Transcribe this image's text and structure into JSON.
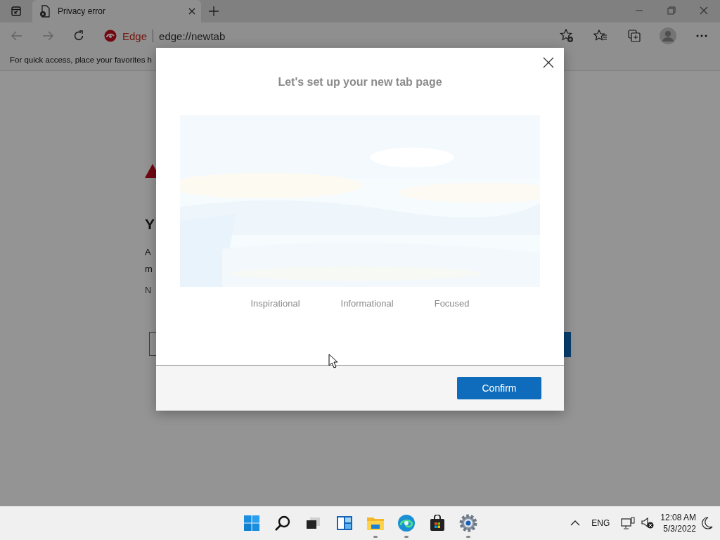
{
  "browser": {
    "tabs": [
      {
        "title": "Privacy error",
        "selected": true
      }
    ],
    "address": {
      "site_label": "Edge",
      "url": "edge://newtab"
    },
    "favorites_bar": {
      "hint": "For quick access, place your favorites h"
    }
  },
  "page": {
    "fragments": [
      {
        "kind": "heading",
        "text": "Y"
      },
      {
        "kind": "line",
        "text": "A"
      },
      {
        "kind": "line",
        "text": "m"
      },
      {
        "kind": "small",
        "text": "N"
      }
    ]
  },
  "dialog": {
    "title": "Let's set up your new tab page",
    "layouts": [
      {
        "label": "Inspirational"
      },
      {
        "label": "Informational"
      },
      {
        "label": "Focused"
      }
    ],
    "button": "Confirm"
  },
  "taskbar": {
    "apps": [
      {
        "kind": "start",
        "running": false
      },
      {
        "kind": "search",
        "running": false
      },
      {
        "kind": "taskview",
        "running": false
      },
      {
        "kind": "widgets",
        "running": false
      },
      {
        "kind": "explorer",
        "running": true
      },
      {
        "kind": "edge",
        "running": true
      },
      {
        "kind": "store",
        "running": false
      },
      {
        "kind": "settings",
        "running": true
      }
    ],
    "language": "ENG",
    "time": "12:08 AM",
    "date": "5/3/2022"
  }
}
